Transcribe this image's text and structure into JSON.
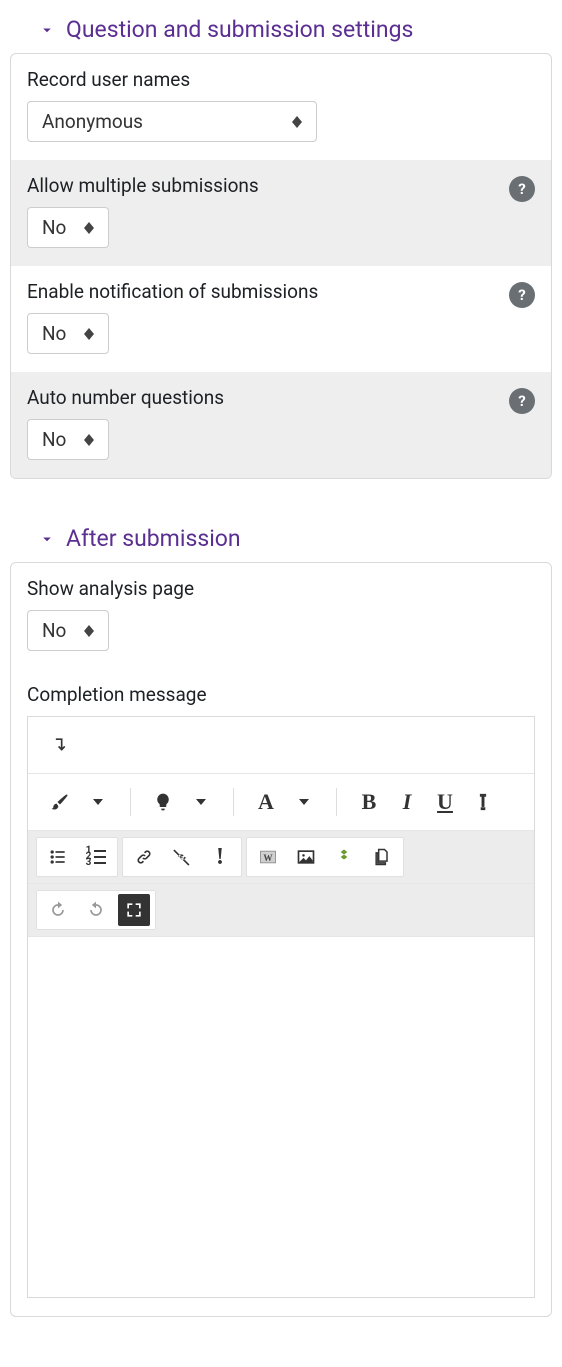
{
  "section1": {
    "title": "Question and submission settings",
    "record_user_names": {
      "label": "Record user names",
      "value": "Anonymous"
    },
    "allow_multiple": {
      "label": "Allow multiple submissions",
      "value": "No"
    },
    "enable_notification": {
      "label": "Enable notification of submissions",
      "value": "No"
    },
    "auto_number": {
      "label": "Auto number questions",
      "value": "No"
    }
  },
  "section2": {
    "title": "After submission",
    "show_analysis": {
      "label": "Show analysis page",
      "value": "No"
    },
    "completion_message": {
      "label": "Completion message"
    }
  },
  "help_glyph": "?",
  "editor": {
    "toggle_toolbar": "toggle-toolbar",
    "buttons": {
      "brush": "style-brush",
      "bulb": "accessibility-helper",
      "font": "font-family",
      "bold": "bold",
      "italic": "italic",
      "underline": "underline",
      "clear": "clear-formatting",
      "ul": "unordered-list",
      "ol": "ordered-list",
      "link": "insert-link",
      "unlink": "remove-link",
      "bang": "prevent-autolink",
      "word": "paste-word",
      "image": "insert-image",
      "media": "insert-media",
      "files": "manage-files",
      "undo": "undo",
      "redo": "redo",
      "fullscreen": "fullscreen"
    }
  }
}
